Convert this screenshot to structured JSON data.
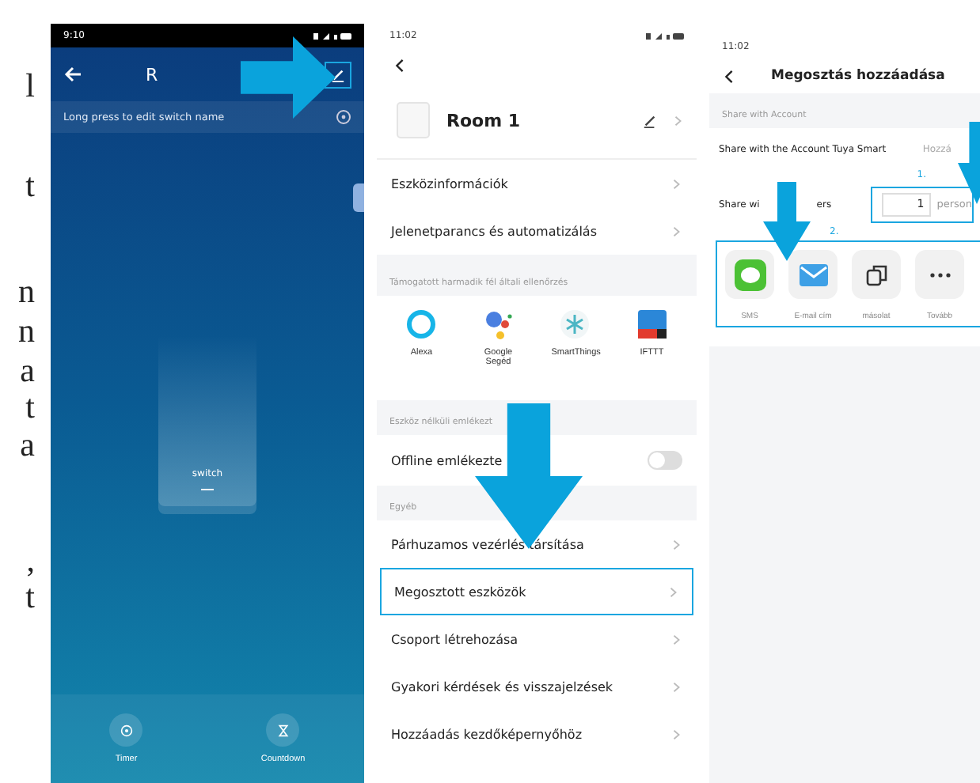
{
  "margin_text": [
    "l",
    "t",
    "n",
    "n",
    "a",
    "t",
    "a",
    ",",
    "t"
  ],
  "phone1": {
    "status_time": "9:10",
    "title": "R",
    "banner": "Long press to edit switch name",
    "switch_label": "switch",
    "bottom_actions": [
      {
        "label": "Timer",
        "kind": "timer"
      },
      {
        "label": "Countdown",
        "kind": "countdown"
      }
    ]
  },
  "phone2": {
    "status_time": "11:02",
    "device_name": "Room 1",
    "rows_top": [
      {
        "label": "Eszközinformációk"
      },
      {
        "label": "Jelenetparancs és automatizálás"
      }
    ],
    "section_1": "Támogatott harmadik fél általi ellenőrzés",
    "integrations": [
      {
        "label": "Alexa",
        "kind": "alexa"
      },
      {
        "label": "Google Segéd",
        "kind": "google"
      },
      {
        "label": "SmartThings",
        "kind": "smartthings"
      },
      {
        "label": "IFTTT",
        "kind": "ifttt"
      }
    ],
    "section_2": "Eszköz nélküli emlékezt",
    "offline": {
      "label": "Offline emlékezte",
      "on": false
    },
    "section_3": "Egyéb",
    "rows_bottom": [
      {
        "label": "Párhuzamos vezérlés társítása",
        "selected": false
      },
      {
        "label": "Megosztott eszközök",
        "selected": true
      },
      {
        "label": "Csoport létrehozása",
        "selected": false
      },
      {
        "label": "Gyakori kérdések és visszajelzések",
        "selected": false
      },
      {
        "label": "Hozzáadás kezdőképernyőhöz",
        "selected": false
      }
    ]
  },
  "phone3": {
    "status_time": "11:02",
    "title": "Megosztás hozzáadása",
    "section": "Share with Account",
    "account_row": {
      "label": "Share with the Account Tuya Smart",
      "action": "Hozzá"
    },
    "step_1": "1.",
    "members_row": {
      "label_start": "Share wi",
      "label_end": "ers",
      "count": "1",
      "unit": "person"
    },
    "step_2": "2.",
    "share_options": [
      {
        "label": "SMS",
        "kind": "sms"
      },
      {
        "label": "E-mail cím",
        "kind": "email"
      },
      {
        "label": "másolat",
        "kind": "copy"
      },
      {
        "label": "Tovább",
        "kind": "more"
      }
    ]
  }
}
